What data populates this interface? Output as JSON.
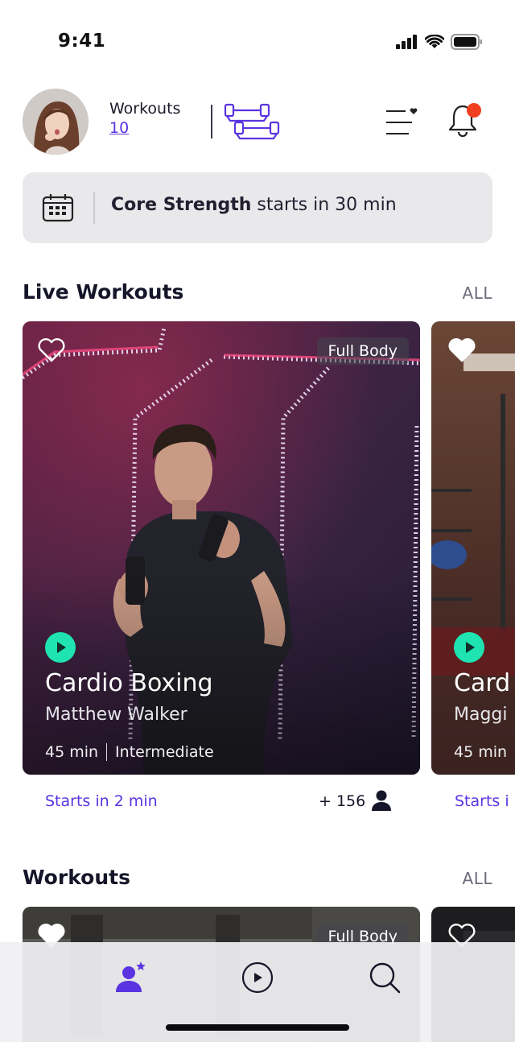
{
  "status": {
    "time": "9:41"
  },
  "profile": {
    "workouts_label": "Workouts",
    "workouts_count": "10"
  },
  "notice": {
    "workout_name": "Core Strength",
    "text": " starts in 30 min"
  },
  "live_section": {
    "title": "Live Workouts",
    "all_label": "ALL",
    "cards": [
      {
        "tag": "Full Body",
        "title": "Cardio Boxing",
        "trainer": "Matthew Walker",
        "duration": "45 min",
        "level": "Intermediate",
        "starts": "Starts in 2 min",
        "participants": "+ 156",
        "favorited": false
      },
      {
        "title": "Card",
        "trainer": "Maggi",
        "duration": "45 min",
        "starts": "Starts i",
        "favorited": true
      }
    ]
  },
  "workouts_section": {
    "title": "Workouts",
    "all_label": "ALL",
    "cards": [
      {
        "tag": "Full Body"
      }
    ]
  },
  "tab_bar": {
    "items": [
      {
        "icon": "profile-star-icon",
        "active": true
      },
      {
        "icon": "play-circle-icon",
        "active": false
      },
      {
        "icon": "search-icon",
        "active": false
      }
    ]
  },
  "colors": {
    "accent": "#5a34e0",
    "play": "#1fe3b0",
    "notification": "#f0401f"
  }
}
